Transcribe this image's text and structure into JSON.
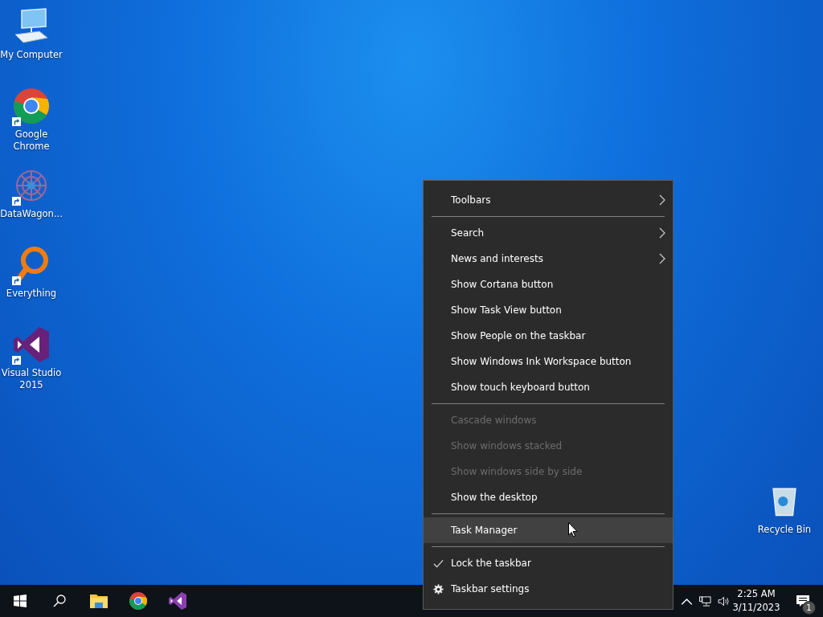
{
  "desktop_icons": [
    {
      "kind": "computer",
      "label": "My Computer",
      "shortcut": false
    },
    {
      "kind": "chrome",
      "label": "Google Chrome",
      "shortcut": true
    },
    {
      "kind": "datawagon",
      "label": "DataWagon...",
      "shortcut": true
    },
    {
      "kind": "everything",
      "label": "Everything",
      "shortcut": true
    },
    {
      "kind": "visualstudio",
      "label": "Visual Studio 2015",
      "shortcut": true
    }
  ],
  "recycle_bin": {
    "label": "Recycle Bin"
  },
  "context_menu": {
    "groups": [
      [
        {
          "kind": "submenu",
          "label": "Toolbars",
          "disabled": false,
          "highlighted": false,
          "checked": false
        }
      ],
      [
        {
          "kind": "submenu",
          "label": "Search",
          "disabled": false,
          "highlighted": false,
          "checked": false
        },
        {
          "kind": "submenu",
          "label": "News and interests",
          "disabled": false,
          "highlighted": false,
          "checked": false
        },
        {
          "kind": "plain",
          "label": "Show Cortana button",
          "disabled": false,
          "highlighted": false,
          "checked": false
        },
        {
          "kind": "plain",
          "label": "Show Task View button",
          "disabled": false,
          "highlighted": false,
          "checked": false
        },
        {
          "kind": "plain",
          "label": "Show People on the taskbar",
          "disabled": false,
          "highlighted": false,
          "checked": false
        },
        {
          "kind": "plain",
          "label": "Show Windows Ink Workspace button",
          "disabled": false,
          "highlighted": false,
          "checked": false
        },
        {
          "kind": "plain",
          "label": "Show touch keyboard button",
          "disabled": false,
          "highlighted": false,
          "checked": false
        }
      ],
      [
        {
          "kind": "plain",
          "label": "Cascade windows",
          "disabled": true,
          "highlighted": false,
          "checked": false
        },
        {
          "kind": "plain",
          "label": "Show windows stacked",
          "disabled": true,
          "highlighted": false,
          "checked": false
        },
        {
          "kind": "plain",
          "label": "Show windows side by side",
          "disabled": true,
          "highlighted": false,
          "checked": false
        },
        {
          "kind": "plain",
          "label": "Show the desktop",
          "disabled": false,
          "highlighted": false,
          "checked": false
        }
      ],
      [
        {
          "kind": "plain",
          "label": "Task Manager",
          "disabled": false,
          "highlighted": true,
          "checked": false
        }
      ],
      [
        {
          "kind": "check",
          "label": "Lock the taskbar",
          "disabled": false,
          "highlighted": false,
          "checked": true
        },
        {
          "kind": "gear",
          "label": "Taskbar settings",
          "disabled": false,
          "highlighted": false,
          "checked": false
        }
      ]
    ]
  },
  "taskbar": {
    "apps": [
      {
        "kind": "explorer"
      },
      {
        "kind": "chrome"
      },
      {
        "kind": "visualstudio"
      }
    ],
    "clock": {
      "time": "2:25 AM",
      "date": "3/11/2023"
    },
    "notifications": {
      "count": "1"
    }
  }
}
